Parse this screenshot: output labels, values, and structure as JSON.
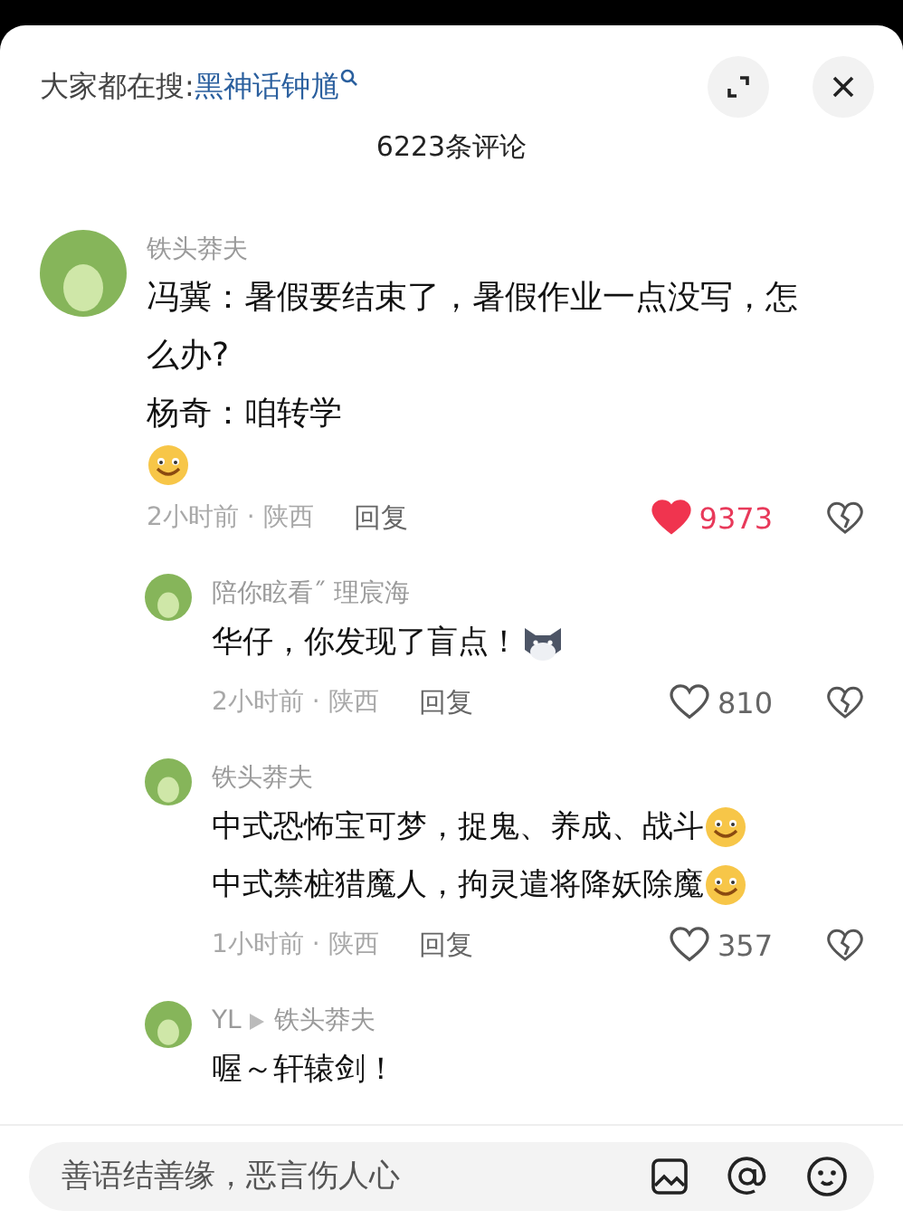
{
  "header": {
    "search_label": "大家都在搜:",
    "search_term": "黑神话钟馗"
  },
  "comment_count": "6223条评论",
  "comments": [
    {
      "author": "铁头莽夫",
      "lines": [
        [
          {
            "kind": "text",
            "text": "冯冀：暑假要结束了，暑假作业一点没写，怎么办?"
          }
        ],
        [
          {
            "kind": "text",
            "text": "杨奇：咱转学"
          }
        ],
        [
          {
            "kind": "smile"
          }
        ]
      ],
      "time": "2小时前 · 陕西",
      "reply": "回复",
      "likes": "9373",
      "liked": true,
      "replies": [
        {
          "author": "陪你眩看˝ 理宸海",
          "lines": [
            [
              {
                "kind": "text",
                "text": "华仔，你发现了盲点！"
              },
              {
                "kind": "cat"
              }
            ]
          ],
          "time": "2小时前 · 陕西",
          "reply": "回复",
          "likes": "810",
          "liked": false
        },
        {
          "author": "铁头莽夫",
          "lines": [
            [
              {
                "kind": "text",
                "text": "中式恐怖宝可梦，捉鬼、养成、战斗"
              },
              {
                "kind": "smile"
              }
            ],
            [
              {
                "kind": "text",
                "text": "中式禁桩猎魔人，拘灵遣将降妖除魔"
              },
              {
                "kind": "smile"
              }
            ]
          ],
          "time": "1小时前 · 陕西",
          "reply": "回复",
          "likes": "357",
          "liked": false
        },
        {
          "author": "YL",
          "reply_to": "铁头莽夫",
          "lines": [
            [
              {
                "kind": "text",
                "text": "喔～轩辕剑！"
              }
            ]
          ]
        }
      ]
    }
  ],
  "input": {
    "placeholder": "善语结善缘，恶言伤人心"
  }
}
